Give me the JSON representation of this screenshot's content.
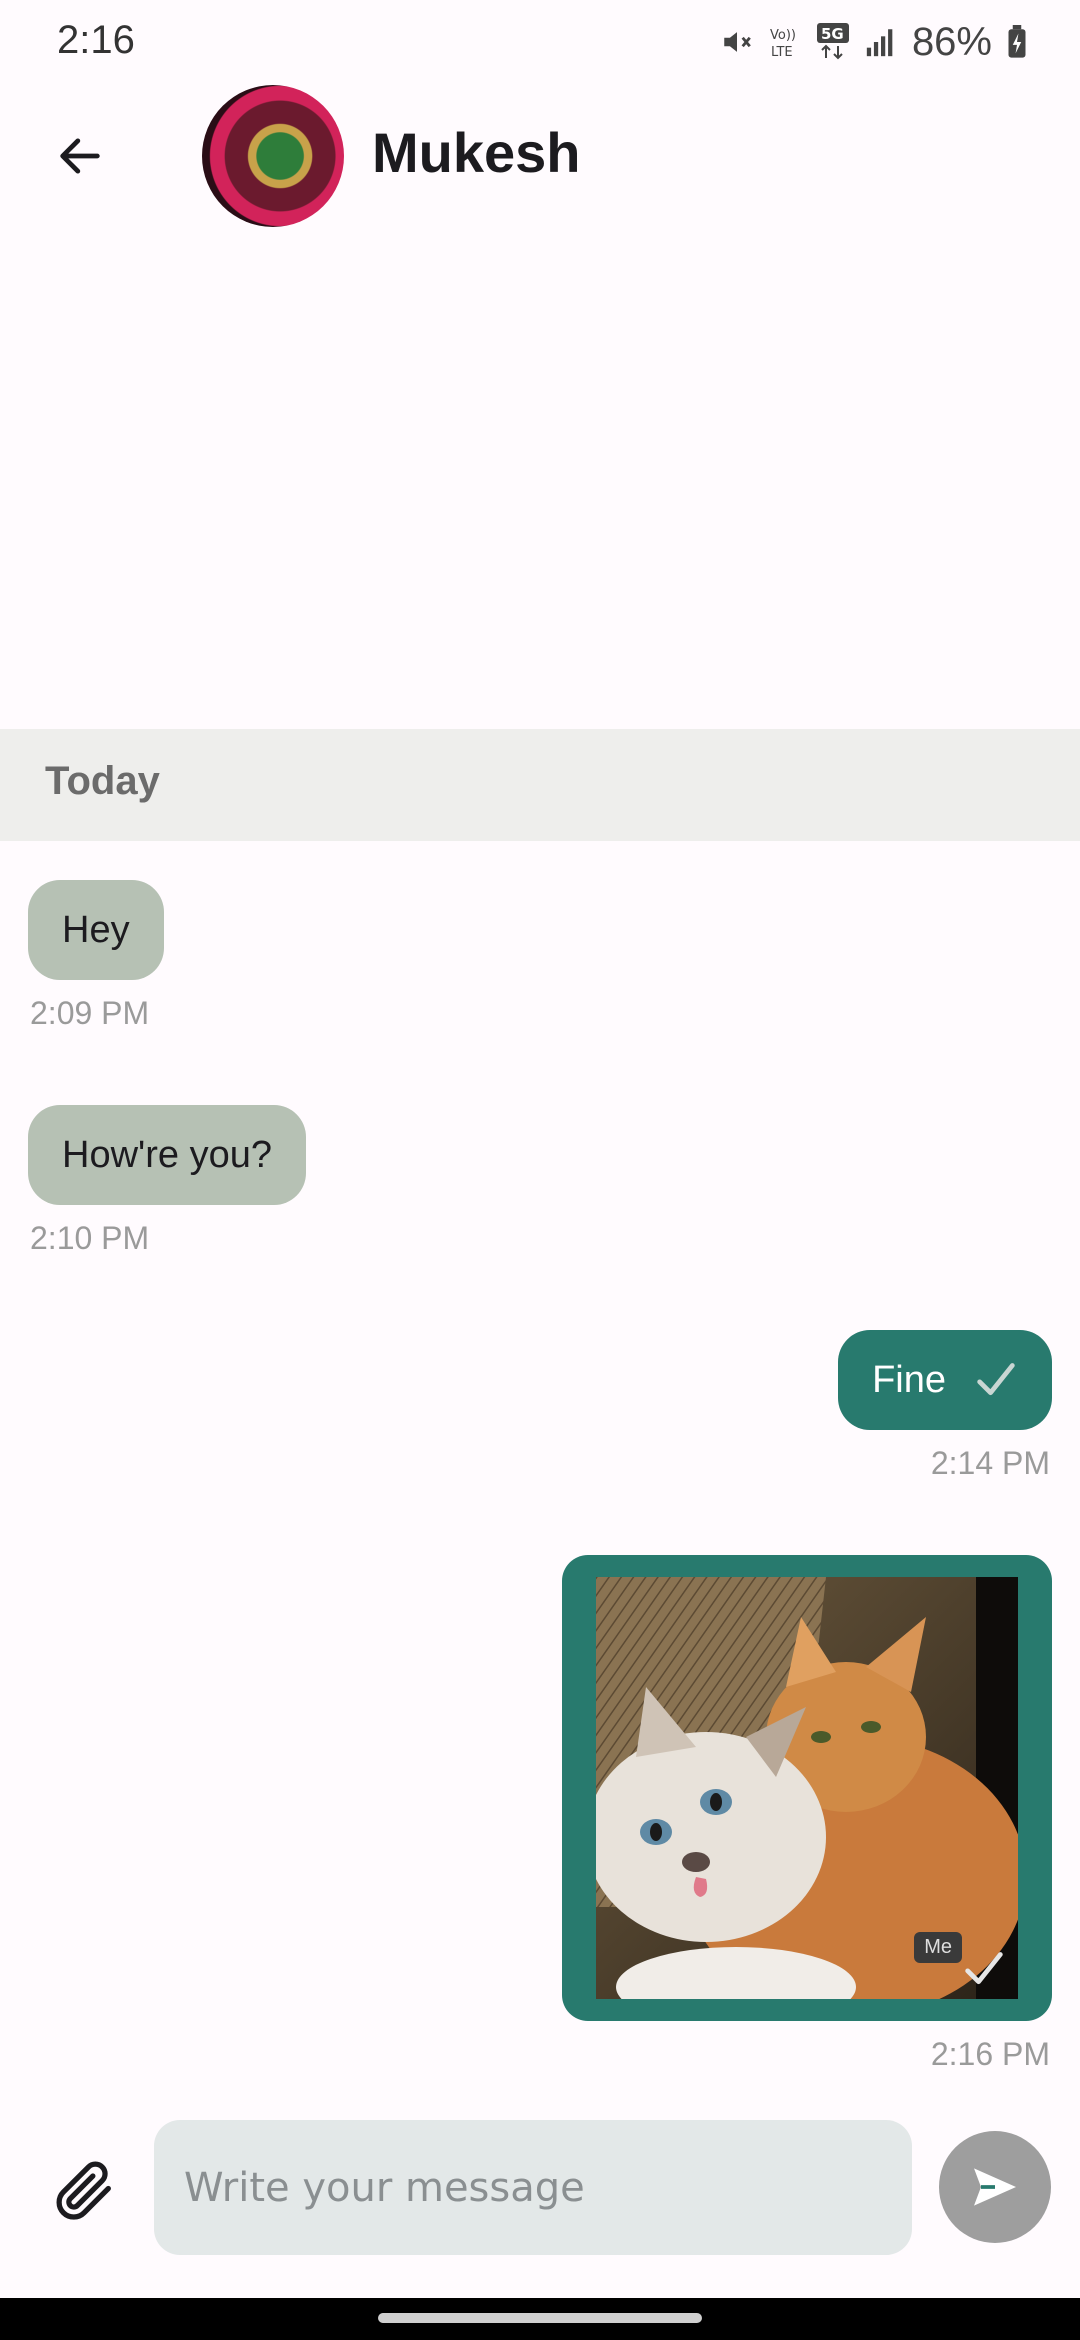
{
  "status_bar": {
    "time": "2:16",
    "battery": "86%",
    "network": "5G",
    "volte": "Vo)) LTE",
    "icons": [
      "mute-icon",
      "volte-icon",
      "5g-icon",
      "signal-icon",
      "battery-charging-icon"
    ]
  },
  "header": {
    "contact_name": "Mukesh",
    "back_icon": "arrow-left-icon"
  },
  "date_divider": {
    "label": "Today"
  },
  "messages": [
    {
      "direction": "incoming",
      "text": "Hey",
      "time": "2:09 PM"
    },
    {
      "direction": "incoming",
      "text": "How're you?",
      "time": "2:10 PM"
    },
    {
      "direction": "outgoing",
      "text": "Fine",
      "time": "2:14 PM",
      "status": "sent"
    },
    {
      "direction": "outgoing",
      "type": "image",
      "image_tag": "Me",
      "time": "2:16 PM",
      "status": "sent"
    }
  ],
  "composer": {
    "placeholder": "Write your message",
    "value": "",
    "attach_icon": "paperclip-icon",
    "send_icon": "send-icon"
  },
  "colors": {
    "incoming_bubble": "#b6c1b4",
    "outgoing_bubble": "#287a6e",
    "divider_bg": "#eeeeec",
    "input_bg": "#e3e8e8",
    "send_button": "#9e9e9e"
  }
}
